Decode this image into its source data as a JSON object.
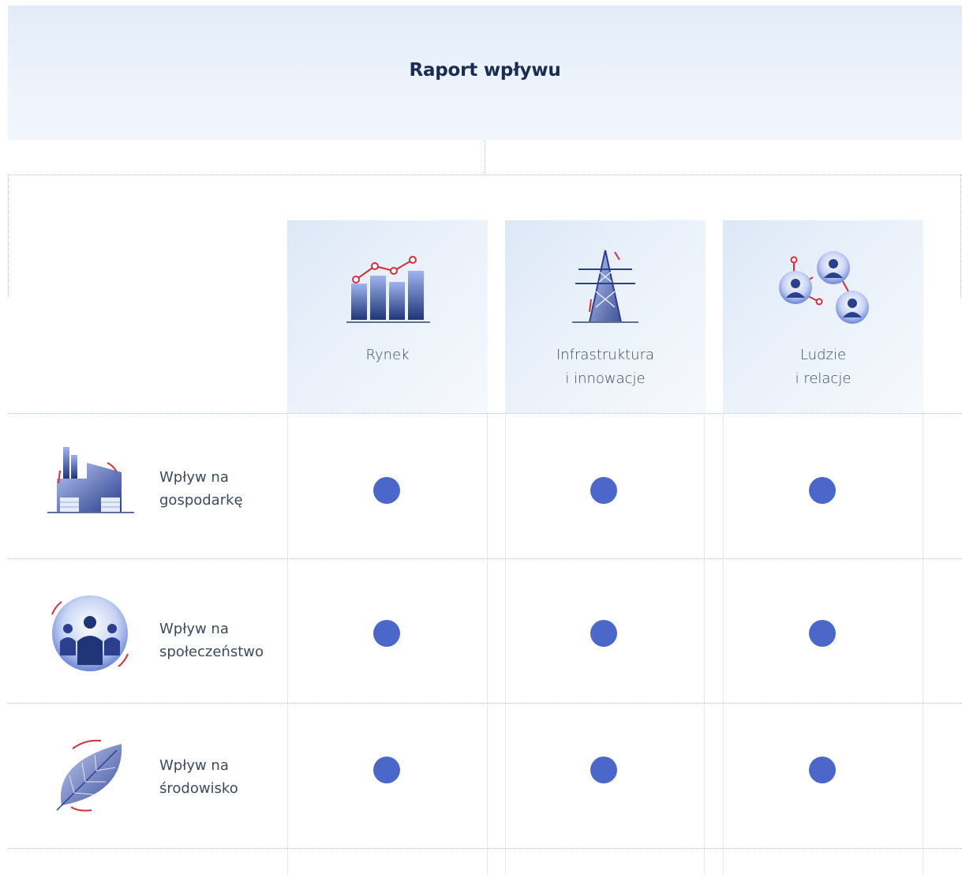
{
  "header": {
    "title": "Raport wpływu"
  },
  "columns": [
    {
      "line1": "Rynek",
      "line2": "",
      "icon": "bar-chart-icon"
    },
    {
      "line1": "Infrastruktura",
      "line2": "i innowacje",
      "icon": "power-tower-icon"
    },
    {
      "line1": "Ludzie",
      "line2": "i relacje",
      "icon": "people-network-icon"
    }
  ],
  "rows": [
    {
      "line1": "Wpływ na",
      "line2": "gospodarkę",
      "icon": "factory-icon",
      "marks": [
        true,
        true,
        true
      ]
    },
    {
      "line1": "Wpływ na",
      "line2": "społeczeństwo",
      "icon": "people-group-icon",
      "marks": [
        true,
        true,
        true
      ]
    },
    {
      "line1": "Wpływ na",
      "line2": "środowisko",
      "icon": "leaf-icon",
      "marks": [
        true,
        true,
        true
      ]
    }
  ],
  "colors": {
    "dot": "#4a67c9",
    "accent": "#d32f3a",
    "title": "#1a2c52"
  }
}
